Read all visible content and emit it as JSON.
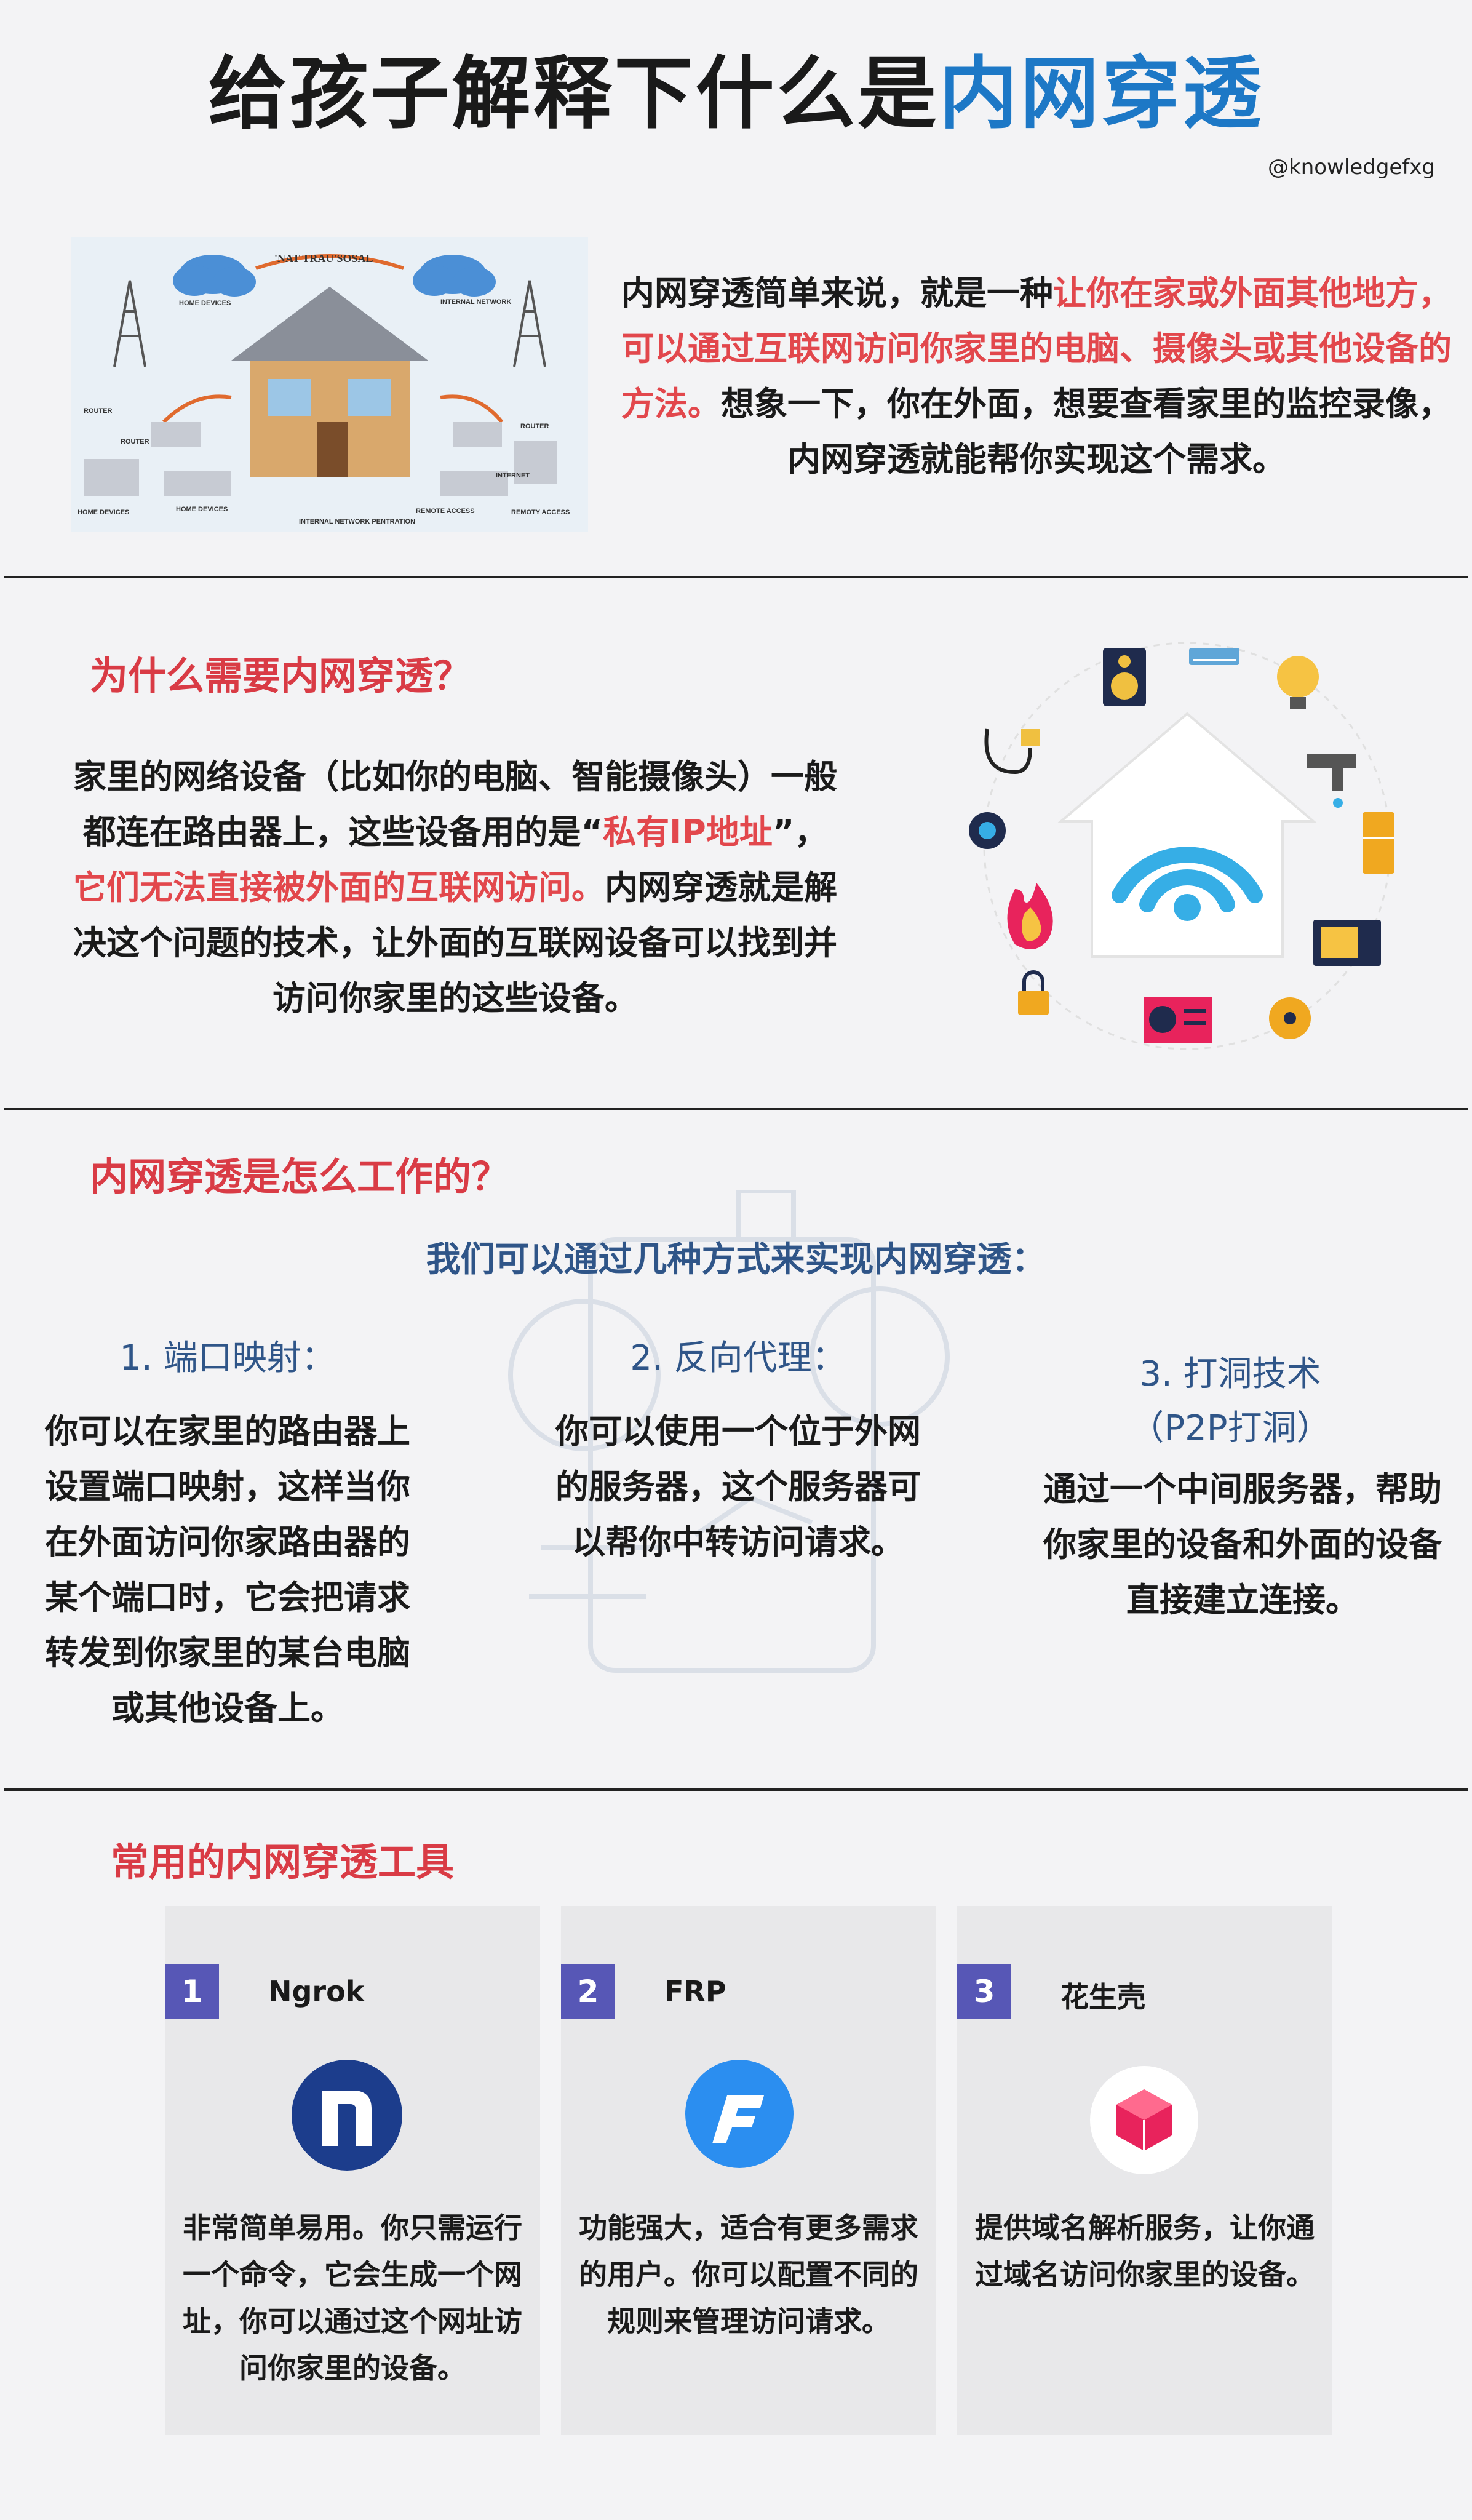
{
  "title": {
    "prefix": "给孩子解释下什么是",
    "highlight": "内网穿透"
  },
  "handle": "@knowledgefxg",
  "intro": {
    "illustration_labels": {
      "top": "'NAT TRAU'SOSAL",
      "home_devices_top": "HOME DEVICES",
      "internal_network": "INTERNAL NETWORK",
      "router_left": "ROUTER",
      "router_left2": "ROUTER",
      "router_right": "ROUTER",
      "internet": "INTERNET",
      "home_devices_bl": "HOME DEVICES",
      "home_devices_bm": "HOME DEVICES",
      "remote_access": "REMOTE ACCESS",
      "remoty_access": "REMOTY ACCESS",
      "penetration": "INTERNAL NETWORK PENTRATION"
    },
    "text_1": "内网穿透简单来说，就是一种",
    "text_red": "让你在家或外面其他地方，可以通过互联网访问你家里的电脑、摄像头或其他设备的方法。",
    "text_2": "想象一下，你在外面，想要查看家里的监控录像，内网穿透就能帮你实现这个需求。"
  },
  "why": {
    "heading": "为什么需要内网穿透？",
    "text_1": "家里的网络设备（比如你的电脑、智能摄像头）一般都连在路由器上，这些设备用的是“",
    "text_red_1": "私有IP地址",
    "text_2": "”，",
    "text_red_2": "它们无法直接被外面的互联网访问。",
    "text_3": "内网穿透就是解决这个问题的技术，让外面的互联网设备可以找到并访问你家里的这些设备。"
  },
  "how": {
    "heading": "内网穿透是怎么工作的？",
    "subheading": "我们可以通过几种方式来实现内网穿透：",
    "methods": [
      {
        "title": "1. 端口映射：",
        "desc": "你可以在家里的路由器上设置端口映射，这样当你在外面访问你家路由器的某个端口时，它会把请求转发到你家里的某台电脑或其他设备上。"
      },
      {
        "title": "2. 反向代理：",
        "desc": "你可以使用一个位于外网的服务器，这个服务器可以帮你中转访问请求。"
      },
      {
        "title": "3. 打洞技术",
        "title2": "（P2P打洞）",
        "desc": "通过一个中间服务器，帮助你家里的设备和外面的设备直接建立连接。"
      }
    ]
  },
  "tools": {
    "heading": "常用的内网穿透工具",
    "items": [
      {
        "num": "1",
        "name": "Ngrok",
        "desc": "非常简单易用。你只需运行一个命令，它会生成一个网址，你可以通过这个网址访问你家里的设备。",
        "logo_color": "#1c3d8c"
      },
      {
        "num": "2",
        "name": "FRP",
        "desc": "功能强大，适合有更多需求的用户。你可以配置不同的规则来管理访问请求。",
        "logo_color": "#2b8ef0"
      },
      {
        "num": "3",
        "name": "花生壳",
        "desc": "提供域名解析服务，让你通过域名访问你家里的设备。",
        "logo_color": "#e8235c"
      }
    ]
  },
  "colors": {
    "accent_blue": "#1d78c6",
    "accent_red": "#e2474c",
    "heading_red": "#d93b45",
    "badge": "#5757b6"
  }
}
